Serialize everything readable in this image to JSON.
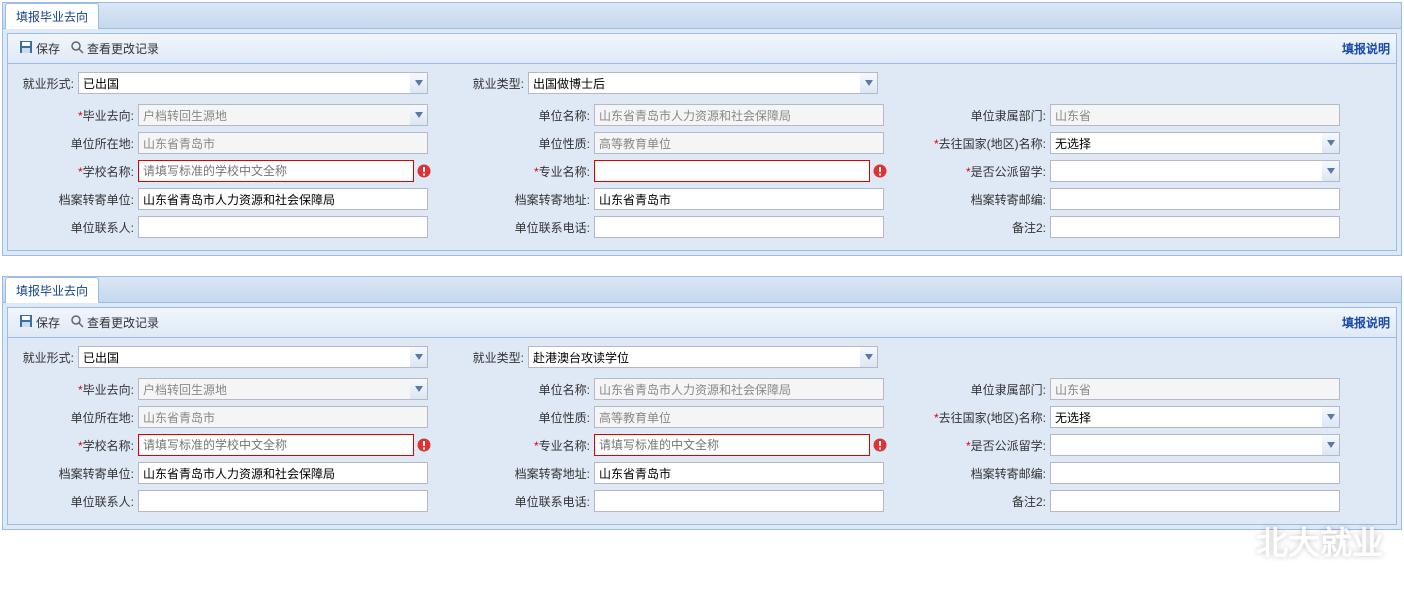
{
  "panels": [
    {
      "tab": "填报毕业去向",
      "toolbar": {
        "save": "保存",
        "history": "查看更改记录",
        "help": "填报说明"
      },
      "top": {
        "employ_form_label": "就业形式:",
        "employ_form_value": "已出国",
        "employ_type_label": "就业类型:",
        "employ_type_value": "出国做博士后"
      },
      "fields": {
        "grad_dest_label": "毕业去向:",
        "grad_dest_value": "户档转回生源地",
        "unit_name_label": "单位名称:",
        "unit_name_value": "山东省青岛市人力资源和社会保障局",
        "unit_dept_label": "单位隶属部门:",
        "unit_dept_value": "山东省",
        "unit_loc_label": "单位所在地:",
        "unit_loc_value": "山东省青岛市",
        "unit_nature_label": "单位性质:",
        "unit_nature_value": "高等教育单位",
        "country_label": "去往国家(地区)名称:",
        "country_value": "无选择",
        "school_label": "学校名称:",
        "school_placeholder": "请填写标准的学校中文全称",
        "major_label": "专业名称:",
        "major_placeholder": "",
        "public_label": "是否公派留学:",
        "public_value": "",
        "archive_unit_label": "档案转寄单位:",
        "archive_unit_value": "山东省青岛市人力资源和社会保障局",
        "archive_addr_label": "档案转寄地址:",
        "archive_addr_value": "山东省青岛市",
        "archive_zip_label": "档案转寄邮编:",
        "archive_zip_value": "",
        "contact_label": "单位联系人:",
        "contact_value": "",
        "phone_label": "单位联系电话:",
        "phone_value": "",
        "note2_label": "备注2:",
        "note2_value": ""
      }
    },
    {
      "tab": "填报毕业去向",
      "toolbar": {
        "save": "保存",
        "history": "查看更改记录",
        "help": "填报说明"
      },
      "top": {
        "employ_form_label": "就业形式:",
        "employ_form_value": "已出国",
        "employ_type_label": "就业类型:",
        "employ_type_value": "赴港澳台攻读学位"
      },
      "fields": {
        "grad_dest_label": "毕业去向:",
        "grad_dest_value": "户档转回生源地",
        "unit_name_label": "单位名称:",
        "unit_name_value": "山东省青岛市人力资源和社会保障局",
        "unit_dept_label": "单位隶属部门:",
        "unit_dept_value": "山东省",
        "unit_loc_label": "单位所在地:",
        "unit_loc_value": "山东省青岛市",
        "unit_nature_label": "单位性质:",
        "unit_nature_value": "高等教育单位",
        "country_label": "去往国家(地区)名称:",
        "country_value": "无选择",
        "school_label": "学校名称:",
        "school_placeholder": "请填写标准的学校中文全称",
        "major_label": "专业名称:",
        "major_placeholder": "请填写标准的中文全称",
        "public_label": "是否公派留学:",
        "public_value": "",
        "archive_unit_label": "档案转寄单位:",
        "archive_unit_value": "山东省青岛市人力资源和社会保障局",
        "archive_addr_label": "档案转寄地址:",
        "archive_addr_value": "山东省青岛市",
        "archive_zip_label": "档案转寄邮编:",
        "archive_zip_value": "",
        "contact_label": "单位联系人:",
        "contact_value": "",
        "phone_label": "单位联系电话:",
        "phone_value": "",
        "note2_label": "备注2:",
        "note2_value": ""
      }
    }
  ],
  "watermark": "北大就业"
}
